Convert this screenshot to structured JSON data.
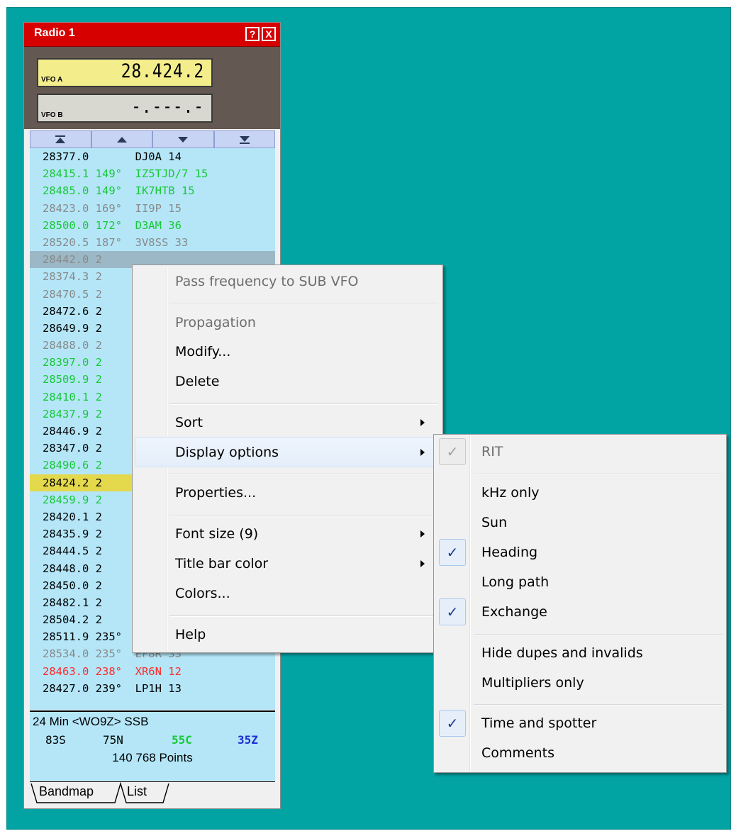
{
  "window": {
    "title": "Radio 1",
    "help_btn": "?",
    "close_btn": "X"
  },
  "vfo": {
    "a_label": "VFO A",
    "a_freq": "28.424.2",
    "b_label": "VFO B",
    "b_freq": "-.---.-"
  },
  "arrows": [
    "top-arrow-icon",
    "up-arrow-icon",
    "down-arrow-icon",
    "bottom-arrow-icon"
  ],
  "spots": [
    {
      "text": "28377.0       DJ0A 14",
      "color": "black"
    },
    {
      "text": "28415.1 149°  IZ5TJD/7 15",
      "color": "green"
    },
    {
      "text": "28485.0 149°  IK7HTB 15",
      "color": "green"
    },
    {
      "text": "28423.0 169°  II9P 15",
      "color": "gray"
    },
    {
      "text": "28500.0 172°  D3AM 36",
      "color": "green"
    },
    {
      "text": "28520.5 187°  3V8SS 33",
      "color": "gray"
    },
    {
      "text": "28442.0 2",
      "color": "gray",
      "highlight": "gray"
    },
    {
      "text": "28374.3 2",
      "color": "gray"
    },
    {
      "text": "28470.5 2",
      "color": "gray"
    },
    {
      "text": "28472.6 2",
      "color": "black"
    },
    {
      "text": "28649.9 2",
      "color": "black"
    },
    {
      "text": "28488.0 2",
      "color": "gray"
    },
    {
      "text": "28397.0 2",
      "color": "green"
    },
    {
      "text": "28509.9 2",
      "color": "green"
    },
    {
      "text": "28410.1 2",
      "color": "green"
    },
    {
      "text": "28437.9 2",
      "color": "green"
    },
    {
      "text": "28446.9 2",
      "color": "black"
    },
    {
      "text": "28347.0 2",
      "color": "black"
    },
    {
      "text": "28490.6 2",
      "color": "green"
    },
    {
      "text": "28424.2 2",
      "color": "black",
      "highlight": "yellow"
    },
    {
      "text": "28459.9 2",
      "color": "green"
    },
    {
      "text": "28420.1 2",
      "color": "black"
    },
    {
      "text": "28435.9 2",
      "color": "black"
    },
    {
      "text": "28444.5 2",
      "color": "black"
    },
    {
      "text": "28448.0 2",
      "color": "black"
    },
    {
      "text": "28450.0 2",
      "color": "black"
    },
    {
      "text": "28482.1 2",
      "color": "black"
    },
    {
      "text": "28504.2 2",
      "color": "black"
    },
    {
      "text": "28511.9 235°  EF8J 33",
      "color": "black"
    },
    {
      "text": "28534.0 235°  EF8R 33",
      "color": "gray"
    },
    {
      "text": "28463.0 238°  XR6N 12",
      "color": "red"
    },
    {
      "text": "28427.0 239°  LP1H 13",
      "color": "black"
    }
  ],
  "status": {
    "line1": "24 Min <WO9Z> SSB",
    "counts": [
      {
        "text": "83S",
        "color": "#000000"
      },
      {
        "text": "75N",
        "color": "#000000"
      },
      {
        "text": "55C",
        "color": "#19c837"
      },
      {
        "text": "35Z",
        "color": "#1d2fd2"
      }
    ],
    "points": "140 768 Points"
  },
  "tabs": {
    "bandmap": "Bandmap",
    "list": "List"
  },
  "context_menu": {
    "pass_freq": "Pass frequency to SUB VFO",
    "propagation": "Propagation",
    "modify": "Modify...",
    "delete": "Delete",
    "sort": "Sort",
    "display_options": "Display options",
    "properties": "Properties...",
    "font_size": "Font size (9)",
    "title_bar_color": "Title bar color",
    "colors": "Colors...",
    "help": "Help"
  },
  "display_submenu": {
    "rit": "RIT",
    "khz_only": "kHz only",
    "sun": "Sun",
    "heading": "Heading",
    "long_path": "Long path",
    "exchange": "Exchange",
    "hide_dupes": "Hide dupes and invalids",
    "multipliers_only": "Multipliers only",
    "time_spotter": "Time and spotter",
    "comments": "Comments",
    "check_glyph": "✓"
  }
}
